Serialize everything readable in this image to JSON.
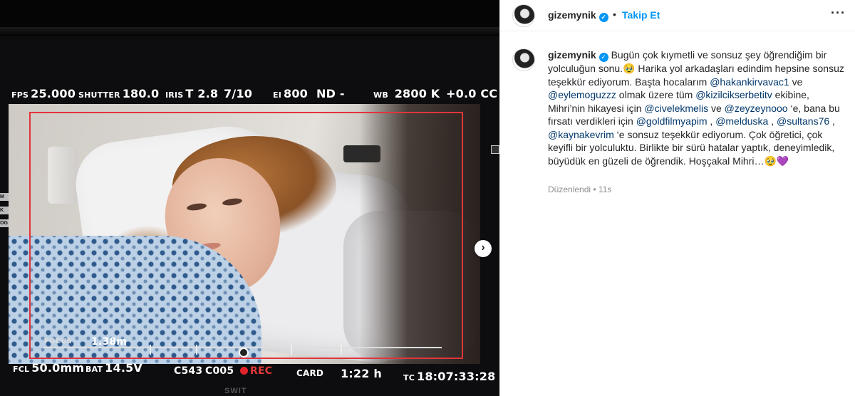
{
  "monitor": {
    "fps_label": "FPS",
    "fps_value": "25.000",
    "shutter_label": "SHUTTER",
    "shutter_value": "180.0",
    "iris_label": "IRIS",
    "iris_value": "T 2.8",
    "iris_fraction": "7/10",
    "ei_label": "EI",
    "ei_value": "800",
    "nd_label": "ND",
    "nd_value": "-",
    "wb_label": "WB",
    "wb_value": "2800 K",
    "cc_value": "+0.0 CC",
    "focus_label": "FOCUS",
    "focus_value": "1.38m",
    "fcl_label": "FCL",
    "fcl_value": "50.0mm",
    "bat_label": "BAT",
    "bat_value": "14.5V",
    "clip": "C543",
    "reel": "C005",
    "rec_label": "REC",
    "card_label": "CARD",
    "card_time": "1:22 h",
    "tc_label": "TC",
    "tc_value": "18:07:33:28",
    "brand": "SWIT",
    "side_tabs": [
      "M",
      "K",
      "OG"
    ]
  },
  "post": {
    "username": "gizemynik",
    "follow_label": "Takip Et",
    "separator": "•",
    "more_label": "···",
    "caption_parts": [
      {
        "t": "text",
        "v": "Bugün çok kıymetli ve sonsuz şey öğrendiğim bir yolculuğun sonu.🥹 Harika yol arkadaşları edindim hepsine sonsuz teşekkür ediyorum. Baştа hocalarım "
      },
      {
        "t": "mention",
        "v": "@hakankirvavac1"
      },
      {
        "t": "text",
        "v": " ve "
      },
      {
        "t": "mention",
        "v": "@eylemoguzzz"
      },
      {
        "t": "text",
        "v": " olmak üzere tüm "
      },
      {
        "t": "mention",
        "v": "@kizilcikserbetitv"
      },
      {
        "t": "text",
        "v": " ekibine, Mihri’nin hikayesi için "
      },
      {
        "t": "mention",
        "v": "@civelekmelis"
      },
      {
        "t": "text",
        "v": " ve "
      },
      {
        "t": "mention",
        "v": "@zeyzeynooo"
      },
      {
        "t": "text",
        "v": " ‘e, bana bu fırsatı verdikleri için "
      },
      {
        "t": "mention",
        "v": "@goldfilmyapim"
      },
      {
        "t": "text",
        "v": " , "
      },
      {
        "t": "mention",
        "v": "@melduska"
      },
      {
        "t": "text",
        "v": " , "
      },
      {
        "t": "mention",
        "v": "@sultans76"
      },
      {
        "t": "text",
        "v": " , "
      },
      {
        "t": "mention",
        "v": "@kaynakevrim"
      },
      {
        "t": "text",
        "v": " ‘e sonsuz teşekkür ediyorum. Çok öğretici, çok keyifli bir yolculuktu. Birlikte bir sürü hatalar yaptık, deneyimledik, büyüdük en güzeli de öğrendik. Hoşçakal Mihri…🥹💜"
      }
    ],
    "edited_label": "Düzenlendi",
    "time_ago": "11s"
  },
  "colors": {
    "accent": "#0095f6",
    "rec": "#e2343c",
    "mention": "#00376b"
  },
  "icons": [
    "verified-badge-icon",
    "more-options-icon",
    "next-arrow-icon"
  ]
}
